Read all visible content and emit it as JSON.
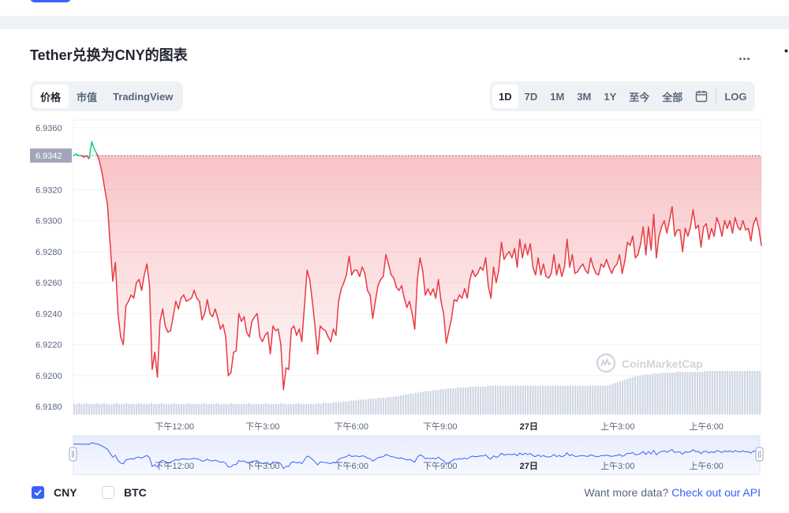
{
  "header": {
    "nav_fragment": ""
  },
  "title": "Tether兑换为CNY的图表",
  "more_label": "...",
  "edge_fragment": "•",
  "metric_tabs": [
    {
      "label": "价格",
      "active": true
    },
    {
      "label": "市值",
      "active": false
    },
    {
      "label": "TradingView",
      "active": false
    }
  ],
  "range_tabs": [
    {
      "label": "1D",
      "active": true
    },
    {
      "label": "7D",
      "active": false
    },
    {
      "label": "1M",
      "active": false
    },
    {
      "label": "3M",
      "active": false
    },
    {
      "label": "1Y",
      "active": false
    },
    {
      "label": "至今",
      "active": false
    },
    {
      "label": "全部",
      "active": false
    }
  ],
  "calendar_icon": "calendar-icon",
  "log_label": "LOG",
  "watermark": "CoinMarketCap",
  "legend": [
    {
      "label": "CNY",
      "checked": true
    },
    {
      "label": "BTC",
      "checked": false
    }
  ],
  "api": {
    "text": "Want more data?",
    "link": "Check out our API"
  },
  "colors": {
    "up": "#16c784",
    "down": "#ea3943",
    "accent": "#3861fb",
    "volume": "#cfd6e4",
    "current_badge": "#a1a7bb"
  },
  "chart_data": {
    "type": "line",
    "ylim": [
      6.9175,
      6.9365
    ],
    "y_ticks": [
      "6.9360",
      "6.9340",
      "6.9320",
      "6.9300",
      "6.9280",
      "6.9260",
      "6.9240",
      "6.9220",
      "6.9200",
      "6.9180"
    ],
    "current_value": "6.9342",
    "x_ticks": [
      "下午12:00",
      "下午3:00",
      "下午6:00",
      "下午9:00",
      "27日",
      "上午3:00",
      "上午6:00"
    ],
    "x_tick_positions": [
      0.147,
      0.275,
      0.404,
      0.533,
      0.662,
      0.791,
      0.92
    ],
    "series": [
      {
        "values": [
          6.9342,
          6.9343,
          6.9342,
          6.9342,
          6.9341,
          6.9342,
          6.934,
          6.9351,
          6.9346,
          6.9343,
          6.9338,
          6.933,
          6.932,
          6.931,
          6.9285,
          6.9261,
          6.9273,
          6.924,
          6.9225,
          6.922,
          6.9245,
          6.9248,
          6.9252,
          6.925,
          6.926,
          6.9262,
          6.9255,
          6.9265,
          6.9272,
          6.9258,
          6.9204,
          6.9215,
          6.9199,
          6.9235,
          6.9243,
          6.9232,
          6.9228,
          6.9229,
          6.9238,
          6.9248,
          6.9243,
          6.925,
          6.9252,
          6.9248,
          6.9249,
          6.925,
          6.9255,
          6.925,
          6.9248,
          6.9236,
          6.924,
          6.9249,
          6.924,
          6.9238,
          6.9243,
          6.9237,
          6.923,
          6.9233,
          6.9225,
          6.92,
          6.9202,
          6.9215,
          6.9216,
          6.924,
          6.9235,
          6.9238,
          6.9228,
          6.9225,
          6.9235,
          6.9238,
          6.924,
          6.9225,
          6.9222,
          6.9226,
          6.9228,
          6.9214,
          6.9232,
          6.9229,
          6.923,
          6.922,
          6.9191,
          6.9205,
          6.9204,
          6.923,
          6.9232,
          6.9226,
          6.923,
          6.9222,
          6.9245,
          6.9268,
          6.9262,
          6.9248,
          6.9232,
          6.9214,
          6.9232,
          6.923,
          6.9229,
          6.9225,
          6.9222,
          6.923,
          6.9226,
          6.9248,
          6.9256,
          6.926,
          6.9265,
          6.9277,
          6.9265,
          6.9268,
          6.9268,
          6.9264,
          6.927,
          6.9266,
          6.9255,
          6.9252,
          6.9237,
          6.9248,
          6.9258,
          6.9262,
          6.9264,
          6.9278,
          6.9272,
          6.9265,
          6.9263,
          6.9257,
          6.9255,
          6.9258,
          6.925,
          6.9244,
          6.9248,
          6.924,
          6.923,
          6.9262,
          6.9276,
          6.9268,
          6.9252,
          6.9256,
          6.9252,
          6.9256,
          6.925,
          6.9262,
          6.9248,
          6.924,
          6.9221,
          6.9229,
          6.9237,
          6.9249,
          6.9248,
          6.9252,
          6.925,
          6.9256,
          6.925,
          6.9262,
          6.9268,
          6.9264,
          6.9266,
          6.927,
          6.9268,
          6.9276,
          6.9258,
          6.925,
          6.927,
          6.926,
          6.9268,
          6.9286,
          6.9275,
          6.9278,
          6.928,
          6.9276,
          6.9282,
          6.927,
          6.9288,
          6.9276,
          6.9285,
          6.9278,
          6.9285,
          6.927,
          6.9265,
          6.9276,
          6.9265,
          6.9272,
          6.9264,
          6.9263,
          6.9266,
          6.9278,
          6.9265,
          6.9272,
          6.9264,
          6.927,
          6.9288,
          6.927,
          6.9278,
          6.9266,
          6.9267,
          6.927,
          6.9272,
          6.9268,
          6.9266,
          6.9276,
          6.927,
          6.9266,
          6.9265,
          6.9272,
          6.927,
          6.9275,
          6.927,
          6.9266,
          6.927,
          6.9272,
          6.9278,
          6.9266,
          6.9274,
          6.9286,
          6.9284,
          6.929,
          6.9276,
          6.9278,
          6.9285,
          6.9296,
          6.9278,
          6.9296,
          6.9281,
          6.9304,
          6.9276,
          6.929,
          6.9296,
          6.93,
          6.9292,
          6.93,
          6.9309,
          6.929,
          6.9294,
          6.9294,
          6.928,
          6.9295,
          6.929,
          6.9296,
          6.9307,
          6.9295,
          6.9297,
          6.9283,
          6.9296,
          6.9298,
          6.9288,
          6.9295,
          6.929,
          6.9302,
          6.9297,
          6.929,
          6.93,
          6.9295,
          6.93,
          6.9292,
          6.9302,
          6.9296,
          6.9294,
          6.93,
          6.9294,
          6.9295,
          6.9287,
          6.9298,
          6.9302,
          6.9295,
          6.9284
        ]
      }
    ],
    "volume": [
      0.62,
      0.62,
      0.63,
      0.62,
      0.62,
      0.63,
      0.62,
      0.62,
      0.62,
      0.63,
      0.62,
      0.62,
      0.63,
      0.62,
      0.62,
      0.62,
      0.62,
      0.63,
      0.62,
      0.62,
      0.62,
      0.63,
      0.62,
      0.62,
      0.62,
      0.62,
      0.63,
      0.62,
      0.62,
      0.62,
      0.62,
      0.63,
      0.62,
      0.62,
      0.62,
      0.63,
      0.62,
      0.62,
      0.62,
      0.62,
      0.63,
      0.62,
      0.62,
      0.62,
      0.62,
      0.62,
      0.63,
      0.62,
      0.62,
      0.62,
      0.62,
      0.62,
      0.63,
      0.62,
      0.62,
      0.62,
      0.62,
      0.63,
      0.62,
      0.62,
      0.62,
      0.62,
      0.62,
      0.63,
      0.62,
      0.62,
      0.62,
      0.62,
      0.62,
      0.62,
      0.63,
      0.62,
      0.62,
      0.62,
      0.62,
      0.62,
      0.62,
      0.63,
      0.62,
      0.62,
      0.62,
      0.62,
      0.62,
      0.63,
      0.62,
      0.62,
      0.62,
      0.62,
      0.62,
      0.62,
      0.63,
      0.62,
      0.62,
      0.62,
      0.62,
      0.62,
      0.62,
      0.62,
      0.63,
      0.62,
      0.63,
      0.63,
      0.63,
      0.63,
      0.64,
      0.64,
      0.64,
      0.64,
      0.65,
      0.65,
      0.65,
      0.66,
      0.66,
      0.66,
      0.67,
      0.67,
      0.67,
      0.67,
      0.68,
      0.68,
      0.68,
      0.68,
      0.69,
      0.69,
      0.69,
      0.69,
      0.7,
      0.7,
      0.7,
      0.71,
      0.71,
      0.72,
      0.72,
      0.73,
      0.73,
      0.74,
      0.74,
      0.75,
      0.75,
      0.76,
      0.76,
      0.77,
      0.77,
      0.77,
      0.78,
      0.78,
      0.78,
      0.79,
      0.79,
      0.79,
      0.8,
      0.8,
      0.8,
      0.8,
      0.81,
      0.81,
      0.81,
      0.81,
      0.81,
      0.82,
      0.82,
      0.82,
      0.82,
      0.82,
      0.82,
      0.82,
      0.83,
      0.83,
      0.83,
      0.83,
      0.83,
      0.83,
      0.83,
      0.83,
      0.83,
      0.83,
      0.83,
      0.83,
      0.83,
      0.83,
      0.83,
      0.83,
      0.83,
      0.83,
      0.83,
      0.83,
      0.83,
      0.83,
      0.83,
      0.83,
      0.83,
      0.83,
      0.83,
      0.83,
      0.83,
      0.83,
      0.83,
      0.83,
      0.83,
      0.83,
      0.83,
      0.83,
      0.83,
      0.83,
      0.83,
      0.83,
      0.83,
      0.83,
      0.83,
      0.83,
      0.83,
      0.83,
      0.83,
      0.83,
      0.83,
      0.84,
      0.85,
      0.86,
      0.87,
      0.88,
      0.89,
      0.9,
      0.91,
      0.92,
      0.93,
      0.94,
      0.94,
      0.95,
      0.95,
      0.96,
      0.96,
      0.96,
      0.97,
      0.97,
      0.97,
      0.97,
      0.98,
      0.98,
      0.98,
      0.98,
      0.98,
      0.98,
      0.99,
      0.99,
      0.99,
      0.99,
      0.99,
      0.99,
      0.99,
      0.99,
      0.99,
      0.99,
      0.99,
      1.0,
      1.0,
      1.0,
      1.0,
      1.0,
      1.0,
      1.0,
      1.0,
      1.0,
      1.0,
      1.0,
      1.0,
      1.0,
      1.0,
      1.0,
      1.0,
      1.0,
      1.0,
      1.0,
      1.0,
      1.0,
      1.0,
      1.0
    ]
  }
}
